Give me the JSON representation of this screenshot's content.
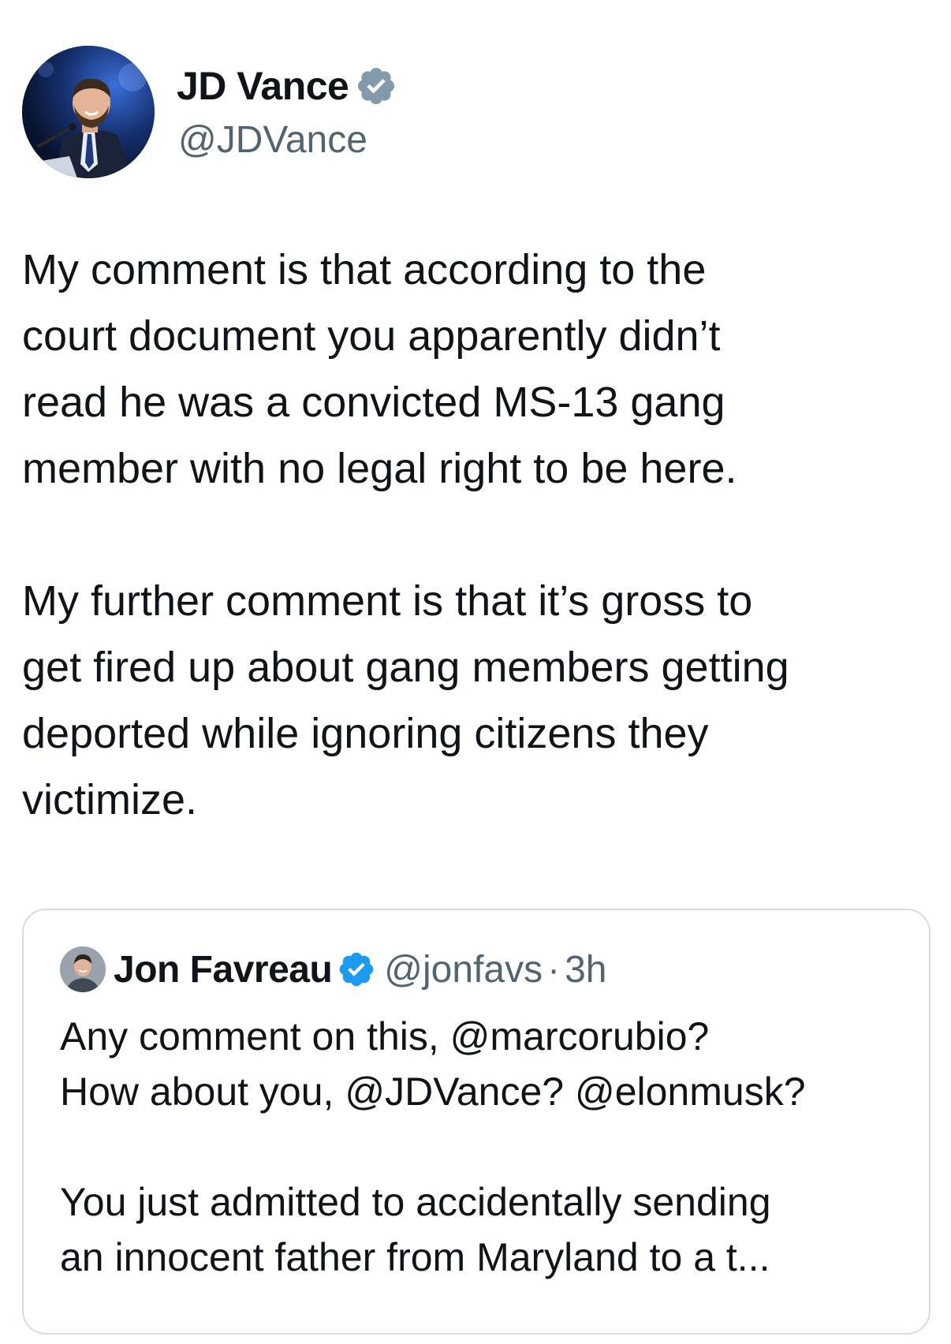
{
  "author": {
    "display_name": "JD Vance",
    "handle": "@JDVance",
    "verified_badge": "verified-badge-gray",
    "badge_color": "#829aab"
  },
  "tweet": {
    "paragraphs": [
      "My comment is that according to the\ncourt document you apparently didn’t\nread he was a convicted MS-13 gang\nmember with no legal right to be here.",
      "My further comment is that it’s gross to\nget fired up about gang members getting\ndeported while ignoring citizens they\nvictimize."
    ]
  },
  "quoted_tweet": {
    "display_name": "Jon Favreau",
    "verified_badge": "verified-badge-blue",
    "badge_color": "#1d9bf0",
    "handle": "@jonfavs",
    "separator": "·",
    "time": "3h",
    "paragraphs": [
      "Any comment on this, @marcorubio?\nHow about you, @JDVance? @elonmusk?",
      "You just admitted to accidentally sending\nan innocent father from Maryland to a t..."
    ]
  },
  "colors": {
    "text_primary": "#0f1419",
    "text_secondary": "#536471",
    "card_border": "#d6dce1"
  }
}
